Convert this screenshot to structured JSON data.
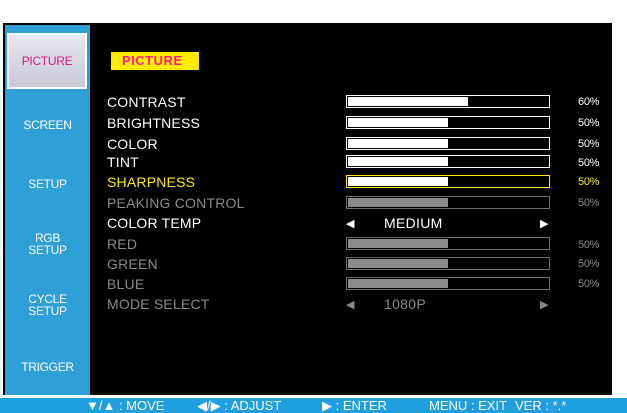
{
  "sidebar": {
    "items": [
      {
        "label": "PICTURE"
      },
      {
        "label": "SCREEN"
      },
      {
        "label": "SETUP"
      },
      {
        "label_line1": "RGB",
        "label_line2": "SETUP"
      },
      {
        "label_line1": "CYCLE",
        "label_line2": "SETUP"
      },
      {
        "label": "TRIGGER"
      }
    ]
  },
  "main": {
    "title": "PICTURE",
    "rows": [
      {
        "label": "CONTRAST",
        "value": "60%",
        "level": 0.6
      },
      {
        "label": "BRIGHTNESS",
        "value": "50%",
        "level": 0.5
      },
      {
        "label": "COLOR",
        "value": "50%",
        "level": 0.5
      },
      {
        "label": "TINT",
        "value": "50%",
        "level": 0.5
      },
      {
        "label": "SHARPNESS",
        "value": "50%",
        "level": 0.5
      },
      {
        "label": "PEAKING CONTROL",
        "value": "50%",
        "level": 0.5
      },
      {
        "label": "COLOR TEMP",
        "selected": "MEDIUM"
      },
      {
        "label": "RED",
        "value": "50%",
        "level": 0.5
      },
      {
        "label": "GREEN",
        "value": "50%",
        "level": 0.5
      },
      {
        "label": "BLUE",
        "value": "50%",
        "level": 0.5
      },
      {
        "label": "MODE SELECT",
        "selected": "1080P"
      }
    ]
  },
  "footer": {
    "move": "▼/▲ : MOVE",
    "adjust": "◀/▶ : ADJUST",
    "enter": "▶ : ENTER",
    "exit": "MENU : EXIT",
    "version": "VER : *.*"
  },
  "colors": {
    "accent_blue": "#1f9ee0",
    "highlight_yellow": "#ffec00",
    "title_pink": "#ff1e8c",
    "disabled_gray": "#8a8a8a"
  }
}
